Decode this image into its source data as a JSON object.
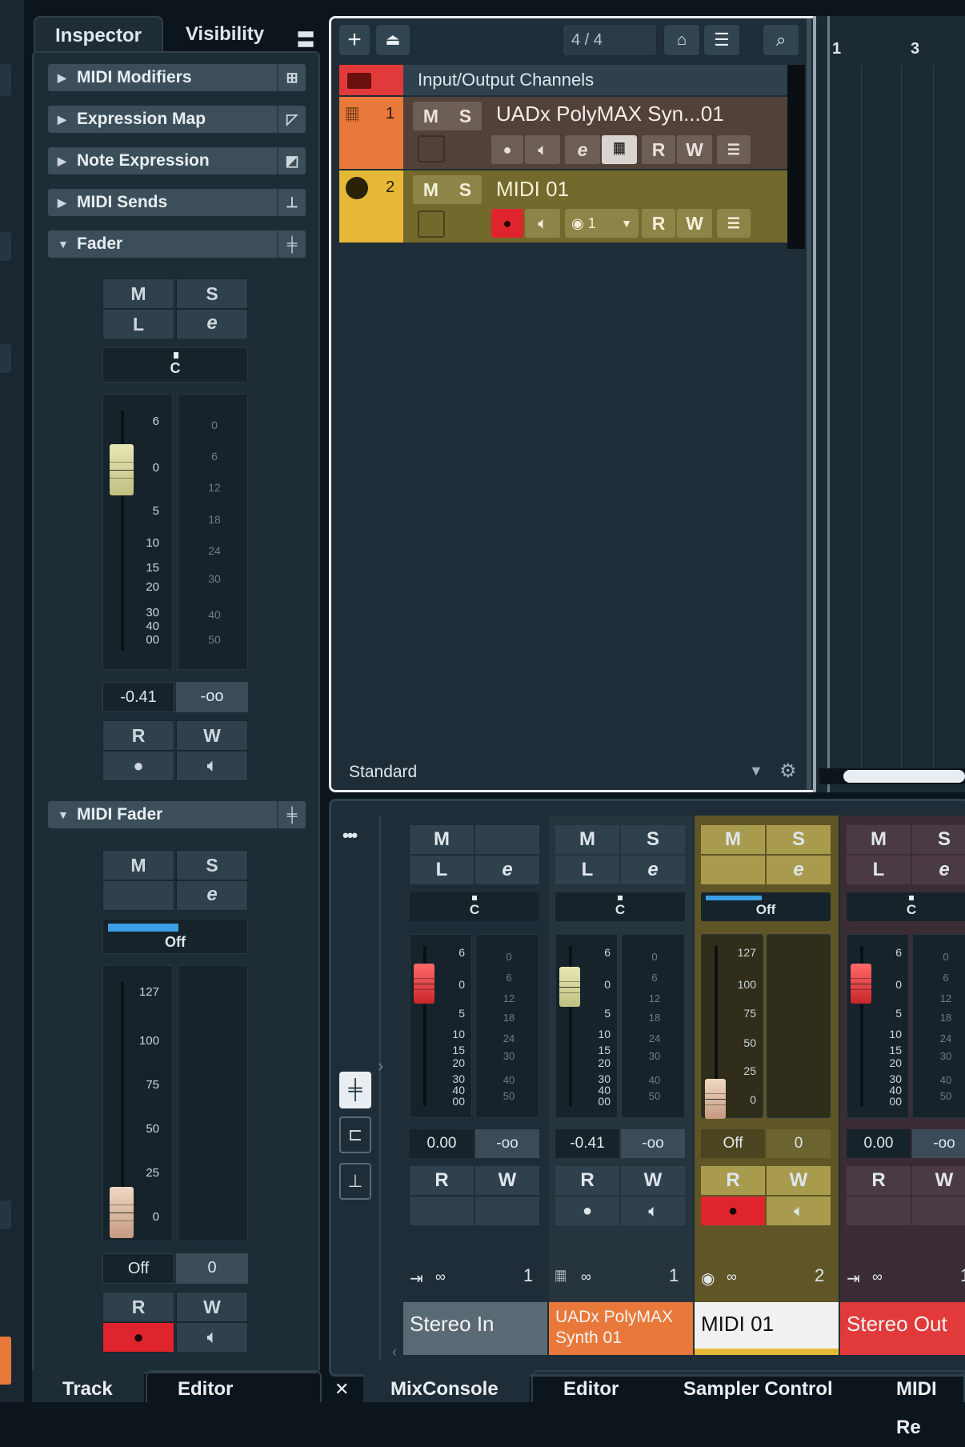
{
  "inspector": {
    "tabs": [
      "Inspector",
      "Visibility"
    ],
    "menu_icon": "menu-icon",
    "sections": [
      {
        "label": "MIDI Modifiers",
        "icon": "midi-modifiers-icon"
      },
      {
        "label": "Expression Map",
        "icon": "expression-map-icon"
      },
      {
        "label": "Note Expression",
        "icon": "note-expression-icon"
      },
      {
        "label": "MIDI Sends",
        "icon": "midi-sends-icon"
      },
      {
        "label": "Fader",
        "icon": "fader-icon"
      }
    ],
    "fader": {
      "m": "M",
      "s": "S",
      "l": "L",
      "e": "e",
      "pan": "C",
      "scale": [
        "6",
        "0",
        "5",
        "10",
        "15",
        "20",
        "30",
        "40",
        "00"
      ],
      "meter_scale": [
        "0",
        "6",
        "12",
        "18",
        "24",
        "30",
        "40",
        "50"
      ],
      "volume": "-0.41",
      "peak": "-oo",
      "r": "R",
      "w": "W"
    },
    "midi_fader_label": "MIDI Fader",
    "midi_fader": {
      "m": "M",
      "s": "S",
      "e": "e",
      "pan": "Off",
      "scale": [
        "127",
        "100",
        "75",
        "50",
        "25",
        "0"
      ],
      "volume": "Off",
      "value": "0",
      "r": "R",
      "w": "W"
    }
  },
  "project": {
    "signature": "4 / 4",
    "folder_label": "Input/Output Channels",
    "tracks": [
      {
        "num": "1",
        "name": "UADx PolyMAX Syn...01",
        "m": "M",
        "s": "S",
        "r": "R",
        "w": "W",
        "color": "#e8793a"
      },
      {
        "num": "2",
        "name": "MIDI 01",
        "m": "M",
        "s": "S",
        "r": "R",
        "w": "W",
        "channel": "1",
        "color": "#e6b837"
      }
    ],
    "ruler": [
      "1",
      "3"
    ],
    "footer_label": "Standard"
  },
  "mixer": {
    "more_label": "•••",
    "strips": [
      {
        "m": "M",
        "s": "",
        "l": "L",
        "e": "e",
        "pan": "C",
        "vol": "0.00",
        "peak": "-oo",
        "r": "R",
        "w": "W",
        "num": "1",
        "name": "Stereo In",
        "name_bg": "#5a6a74",
        "bg": "#1e2d37"
      },
      {
        "m": "M",
        "s": "S",
        "l": "L",
        "e": "e",
        "pan": "C",
        "vol": "-0.41",
        "peak": "-oo",
        "r": "R",
        "w": "W",
        "num": "1",
        "name": "UADx PolyMAX Synth 01",
        "name_bg": "#e8793a",
        "bg": "#26343d"
      },
      {
        "m": "M",
        "s": "S",
        "l": "",
        "e": "e",
        "pan": "Off",
        "vol": "Off",
        "peak": "0",
        "r": "R",
        "w": "W",
        "num": "2",
        "name": "MIDI 01",
        "name_bg": "#f1f1f1",
        "bg": "#5f5526"
      },
      {
        "m": "M",
        "s": "S",
        "l": "L",
        "e": "e",
        "pan": "C",
        "vol": "0.00",
        "peak": "-oo",
        "r": "R",
        "w": "W",
        "num": "1",
        "name": "Stereo Out",
        "name_bg": "#e23a3a",
        "bg": "#3a2c34"
      }
    ],
    "audio_scale": [
      "6",
      "0",
      "5",
      "10",
      "15",
      "20",
      "30",
      "40",
      "00"
    ],
    "meter_scale": [
      "0",
      "6",
      "12",
      "18",
      "24",
      "30",
      "40",
      "50"
    ],
    "midi_scale": [
      "127",
      "100",
      "75",
      "50",
      "25",
      "0"
    ]
  },
  "bottom_tabs": {
    "left": [
      "Track",
      "Editor"
    ],
    "right": [
      "MixConsole",
      "Editor",
      "Sampler Control",
      "MIDI Re"
    ],
    "close": "✕"
  }
}
